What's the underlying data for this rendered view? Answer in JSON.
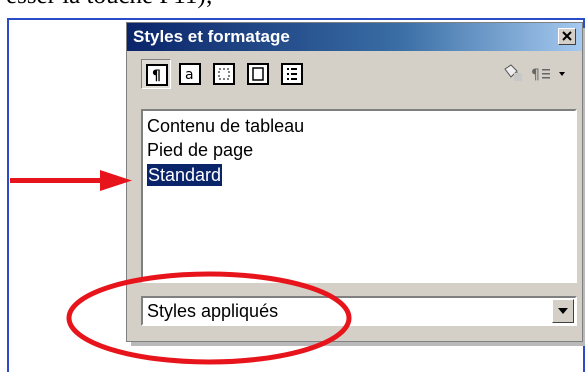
{
  "document": {
    "partial_text": "esser la touche F11);"
  },
  "panel": {
    "title": "Styles et formatage",
    "close_icon": "close-icon",
    "toolbar": {
      "buttons": [
        {
          "name": "paragraph-styles-icon",
          "pressed": true
        },
        {
          "name": "character-styles-icon",
          "pressed": false
        },
        {
          "name": "frame-styles-icon",
          "pressed": false
        },
        {
          "name": "page-styles-icon",
          "pressed": false
        },
        {
          "name": "list-styles-icon",
          "pressed": false
        }
      ],
      "right_icons": [
        "fill-format-mode-icon",
        "new-style-from-selection-icon"
      ]
    },
    "styles_list": {
      "items": [
        "Contenu de tableau",
        "Pied de page",
        "Standard"
      ],
      "selected": "Standard"
    },
    "filter": {
      "selected": "Styles appliqués"
    }
  },
  "annotations": {
    "arrow_color": "#e8141c",
    "ellipse_color": "#e8141c"
  },
  "colors": {
    "title_bar": "#0a246a",
    "selection": "#0a246a",
    "frame_border": "#2b4cc8"
  }
}
